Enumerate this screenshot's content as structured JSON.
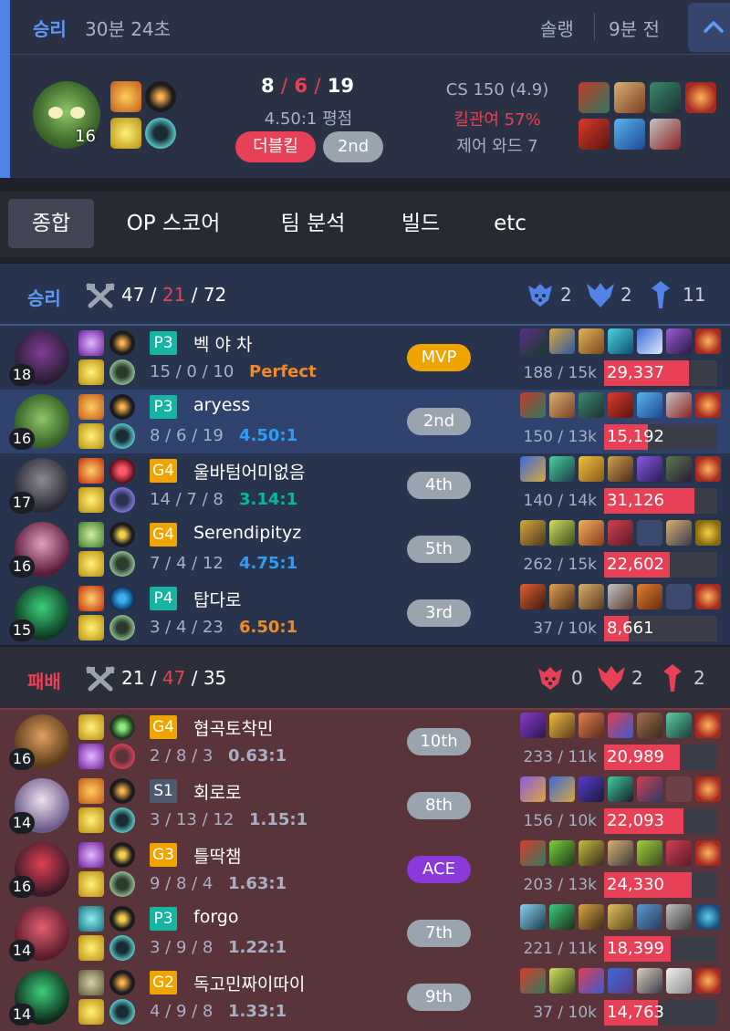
{
  "match": {
    "result": "승리",
    "duration": "30분 24초",
    "queue": "솔랭",
    "time_ago": "9분 전",
    "champion_level": "16",
    "kda": {
      "kills": "8",
      "deaths": "6",
      "assists": "19"
    },
    "ratio": "4.50:1 평점",
    "multikill": "더블킬",
    "placement": "2nd",
    "cs": "CS 150 (4.9)",
    "kill_participation": "킬관여 57%",
    "control_wards": "제어 와드 7"
  },
  "tabs": [
    {
      "label": "종합",
      "active": true
    },
    {
      "label": "OP 스코어"
    },
    {
      "label": "팀 분석"
    },
    {
      "label": "빌드"
    },
    {
      "label": "etc"
    }
  ],
  "teams": [
    {
      "label": "승리",
      "kills": "47",
      "deaths": "21",
      "assists": "72",
      "objectives": {
        "baron": "2",
        "dragon": "2",
        "tower": "11"
      },
      "players": [
        {
          "level": "18",
          "tier": "P3",
          "name": "벡 야 차",
          "kda": "15 / 0 / 10",
          "ratio": "Perfect",
          "ratio_color": "#f08a24",
          "badge": "MVP",
          "cs": "188 / 15k",
          "damage": "29,337",
          "damage_fraction": 0.75
        },
        {
          "level": "16",
          "tier": "P3",
          "name": "aryess",
          "kda": "8 / 6 / 19",
          "ratio": "4.50:1",
          "ratio_color": "#2d9ef7",
          "badge": "2nd",
          "cs": "150 / 13k",
          "damage": "15,192",
          "damage_fraction": 0.39,
          "highlight": true
        },
        {
          "level": "17",
          "tier": "G4",
          "name": "울바텀어미없음",
          "kda": "14 / 7 / 8",
          "ratio": "3.14:1",
          "ratio_color": "#00bba3",
          "badge": "4th",
          "cs": "140 / 14k",
          "damage": "31,126",
          "damage_fraction": 0.8
        },
        {
          "level": "16",
          "tier": "G4",
          "name": "Serendipityz",
          "kda": "7 / 4 / 12",
          "ratio": "4.75:1",
          "ratio_color": "#2d9ef7",
          "badge": "5th",
          "cs": "262 / 15k",
          "damage": "22,602",
          "damage_fraction": 0.58
        },
        {
          "level": "15",
          "tier": "P4",
          "name": "탑다로",
          "kda": "3 / 4 / 23",
          "ratio": "6.50:1",
          "ratio_color": "#f08a24",
          "badge": "3rd",
          "cs": "37 / 10k",
          "damage": "8,661",
          "damage_fraction": 0.22
        }
      ]
    },
    {
      "label": "패배",
      "kills": "21",
      "deaths": "47",
      "assists": "35",
      "objectives": {
        "baron": "0",
        "dragon": "2",
        "tower": "2"
      },
      "players": [
        {
          "level": "16",
          "tier": "G4",
          "name": "협곡토착민",
          "kda": "2 / 8 / 3",
          "ratio": "0.63:1",
          "ratio_color": "#a7b0c4",
          "badge": "10th",
          "cs": "233 / 11k",
          "damage": "20,989",
          "damage_fraction": 0.54
        },
        {
          "level": "14",
          "tier": "S1",
          "name": "회로로",
          "kda": "3 / 13 / 12",
          "ratio": "1.15:1",
          "ratio_color": "#a7b0c4",
          "badge": "8th",
          "cs": "156 / 10k",
          "damage": "22,093",
          "damage_fraction": 0.57
        },
        {
          "level": "16",
          "tier": "G3",
          "name": "틀딱챔",
          "kda": "9 / 8 / 4",
          "ratio": "1.63:1",
          "ratio_color": "#a7b0c4",
          "badge": "ACE",
          "cs": "203 / 13k",
          "damage": "24,330",
          "damage_fraction": 0.63
        },
        {
          "level": "14",
          "tier": "P3",
          "name": "forgo",
          "kda": "3 / 9 / 8",
          "ratio": "1.22:1",
          "ratio_color": "#a7b0c4",
          "badge": "7th",
          "cs": "221 / 11k",
          "damage": "18,399",
          "damage_fraction": 0.47
        },
        {
          "level": "14",
          "tier": "G2",
          "name": "독고민짜이따이",
          "kda": "4 / 9 / 8",
          "ratio": "1.33:1",
          "ratio_color": "#a7b0c4",
          "badge": "9th",
          "cs": "37 / 10k",
          "damage": "14,763",
          "damage_fraction": 0.38
        }
      ]
    }
  ],
  "colors": {
    "win": "#5383e8",
    "loss": "#e84057",
    "win_row": "#28344e",
    "win_row_highlight": "#2f436e",
    "loss_row": "#59343b",
    "gold_tier": "#f0a400",
    "platinum_tier": "#16b5a2",
    "silver_tier": "#4d5a70"
  },
  "icons": {
    "collapse": "chevron-up-icon",
    "team_kda": "crossed-swords-icon",
    "baron": "baron-icon",
    "dragon": "dragon-icon",
    "tower": "tower-icon"
  }
}
